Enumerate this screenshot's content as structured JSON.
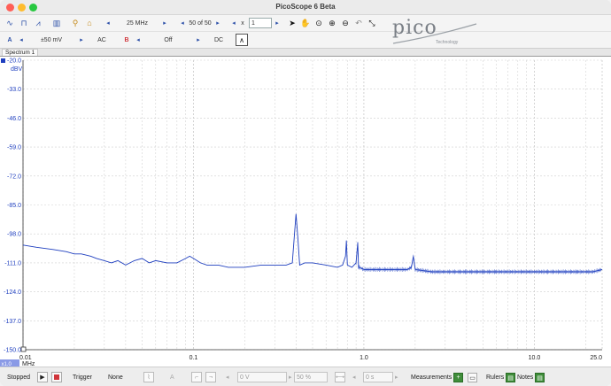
{
  "window": {
    "title": "PicoScope 6 Beta"
  },
  "toolbar1": {
    "bandwidth": "25 MHz",
    "capture": "50 of 50",
    "zoom_prefix": "x",
    "zoom_value": "1"
  },
  "toolbar2": {
    "channel_a": "A",
    "range_a": "±50 mV",
    "coupling_a": "AC",
    "channel_b": "B",
    "range_b": "Off",
    "coupling_b": "DC"
  },
  "logo": {
    "brand": "pico",
    "tagline": "Technology"
  },
  "tabs": [
    {
      "label": "Spectrum 1"
    }
  ],
  "chart_data": {
    "type": "line",
    "title": "",
    "xlabel": "MHz",
    "ylabel": "dBV",
    "x_scale": "log",
    "xlim": [
      0.01,
      25.0
    ],
    "ylim": [
      -150.0,
      -20.0
    ],
    "x_ticks": [
      "0.01",
      "0.1",
      "1.0",
      "10.0",
      "25.0"
    ],
    "y_ticks": [
      "-20.0",
      "-33.0",
      "-46.0",
      "-59.0",
      "-72.0",
      "-85.0",
      "-98.0",
      "-111.0",
      "-124.0",
      "-137.0",
      "-150.0"
    ],
    "grid": true,
    "series": [
      {
        "color": "#1f3fbf",
        "x": [
          0.01,
          0.012,
          0.015,
          0.018,
          0.02,
          0.022,
          0.025,
          0.027,
          0.03,
          0.033,
          0.036,
          0.04,
          0.045,
          0.05,
          0.055,
          0.06,
          0.07,
          0.08,
          0.09,
          0.095,
          0.1,
          0.11,
          0.12,
          0.14,
          0.16,
          0.18,
          0.2,
          0.25,
          0.3,
          0.35,
          0.38,
          0.39,
          0.4,
          0.41,
          0.42,
          0.45,
          0.5,
          0.6,
          0.7,
          0.75,
          0.78,
          0.79,
          0.8,
          0.85,
          0.9,
          0.92,
          0.93,
          0.94,
          1.0,
          1.2,
          1.5,
          1.8,
          1.9,
          1.95,
          2.0,
          2.5,
          3,
          4,
          5,
          6,
          8,
          10,
          12,
          15,
          18,
          20,
          22,
          25
        ],
        "y": [
          -103,
          -104,
          -105,
          -106,
          -107,
          -107,
          -108,
          -109,
          -110,
          -111,
          -110,
          -112,
          -110,
          -109,
          -111,
          -110,
          -111,
          -111,
          -109,
          -108,
          -109,
          -111,
          -112,
          -112,
          -113,
          -113,
          -113,
          -112,
          -112,
          -112,
          -111,
          -100,
          -89,
          -100,
          -112,
          -111,
          -111,
          -112,
          -113,
          -112,
          -108,
          -101,
          -112,
          -113,
          -111,
          -102,
          -113,
          -113,
          -114,
          -114,
          -114,
          -114,
          -113,
          -108,
          -114,
          -115,
          -115,
          -115,
          -115,
          -115,
          -115,
          -115,
          -115,
          -115,
          -115,
          -115,
          -115,
          -114
        ]
      }
    ]
  },
  "statusbar": {
    "run_state": "Stopped",
    "trigger_label": "Trigger",
    "trigger_mode": "None",
    "trigger_channel": "A",
    "threshold": "0 V",
    "pre_trigger": "50 %",
    "delay": "0 s",
    "measurements": "Measurements",
    "rulers": "Rulers",
    "notes": "Notes"
  }
}
